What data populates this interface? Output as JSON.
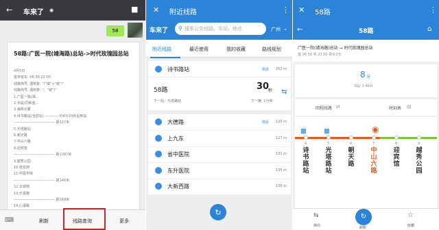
{
  "p1": {
    "title": "车来了",
    "bubble": "58",
    "msg_title": "58路:广医一院(靖海路)总站->时代玫瑰园总站",
    "lines": [
      "4月5日",
      "首末班车: 06:30-22:00",
      "线路简号, 遇到复: \"!\"或\"+\"或\"!\"",
      "线路简号, 遇到复: \"、\"或\")\"",
      "1.广医一院(靖...",
      "2.长堤(同和金...",
      "3.海晖大厦",
      "4.诗书路站(当前站) ———— 约6分20秒后到站",
      "———————————— 距327米",
      "5.光塔路站",
      "6.朝天路",
      "7.中山六路",
      "8.迎宾馆",
      "———————————— 距1387米",
      "9.越秀公园",
      "10.桂花岗",
      "11.中医学院",
      "———————————— 距145米",
      "12.云城南",
      "13.乐嘉路",
      "———————————— 距169米",
      "14.心语路"
    ],
    "b_refresh": "刷新",
    "b_query": "线路查询",
    "b_more": "更多"
  },
  "p2": {
    "title": "附近线路",
    "logo": "车来了",
    "placeholder": "搜索公交线路、车站、地点",
    "city": "广州",
    "tabs": [
      "附近线路",
      "最近使用",
      "我的收藏",
      "路线规划"
    ],
    "stop1": "诗书路站",
    "stop1_tag": "附近",
    "stop1_dist": "252 m",
    "route": "58路",
    "eta": "30",
    "eta_unit": "秒",
    "next": "下一站：光塔路站",
    "next_r": "下一辆: 1分钟",
    "stops": [
      {
        "name": "大德路",
        "tag": "附近",
        "dist": "120 m"
      },
      {
        "name": "上九东",
        "tag": "",
        "dist": "127 m"
      },
      {
        "name": "省中医院",
        "tag": "",
        "dist": "131 m"
      },
      {
        "name": "东升医院",
        "tag": "",
        "dist": "135 m"
      },
      {
        "name": "大新西路",
        "tag": "",
        "dist": "138 m"
      }
    ]
  },
  "p3": {
    "title": "58路",
    "heading": "58路",
    "info1": "广医一院(靖海路)总站 → 时代玫瑰园总站",
    "info2": "首 06:30  末 22:00  票价2元",
    "wait_num": "8",
    "wait_unit": "分",
    "wait_sub": "3站/ 1.4km",
    "link1": "回程线路",
    "link2": "时刻表",
    "stations": [
      {
        "n": "4",
        "name": "诗书路站"
      },
      {
        "n": "5",
        "name": "光塔路站"
      },
      {
        "n": "6",
        "name": "朝天路"
      },
      {
        "n": "7",
        "name": "中山六路"
      },
      {
        "n": "8",
        "name": "迎宾馆"
      },
      {
        "n": "9",
        "name": "越秀公园"
      }
    ],
    "nav": [
      "换向",
      "刷新",
      "收藏"
    ]
  },
  "colors": {
    "blue": "#2c84d8",
    "dark": "#393a3f",
    "highlight": "#e85a1a",
    "red": "#c0262d"
  }
}
